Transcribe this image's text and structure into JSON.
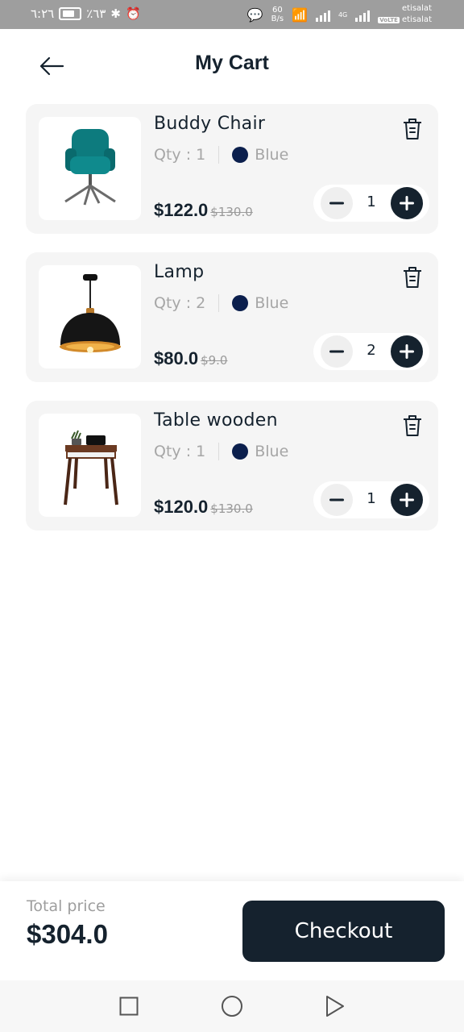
{
  "status_bar": {
    "time": "٦:٢٦",
    "battery": "٪٦٣",
    "speed_value": "60",
    "speed_unit": "B/s",
    "network_1": "4G",
    "network_2": "4G",
    "carrier_1": "etisalat",
    "carrier_2": "etisalat",
    "volte": "VoLTE"
  },
  "header": {
    "title": "My Cart"
  },
  "cart": {
    "items": [
      {
        "name": "Buddy Chair",
        "qty_label": "Qty : 1",
        "color_name": "Blue",
        "color_hex": "#0b1f4d",
        "price": "$122.0",
        "old_price": "$130.0",
        "quantity": "1",
        "image_icon": "chair-image"
      },
      {
        "name": "Lamp",
        "qty_label": "Qty : 2",
        "color_name": "Blue",
        "color_hex": "#0b1f4d",
        "price": "$80.0",
        "old_price": "$9.0",
        "quantity": "2",
        "image_icon": "lamp-image"
      },
      {
        "name": "Table wooden",
        "qty_label": "Qty : 1",
        "color_name": "Blue",
        "color_hex": "#0b1f4d",
        "price": "$120.0",
        "old_price": "$130.0",
        "quantity": "1",
        "image_icon": "table-image"
      }
    ]
  },
  "footer": {
    "total_label": "Total price",
    "total_value": "$304.0",
    "checkout_label": "Checkout"
  },
  "colors": {
    "primary": "#15222e",
    "card_bg": "#f5f5f5",
    "muted_text": "#a6a6a6"
  }
}
